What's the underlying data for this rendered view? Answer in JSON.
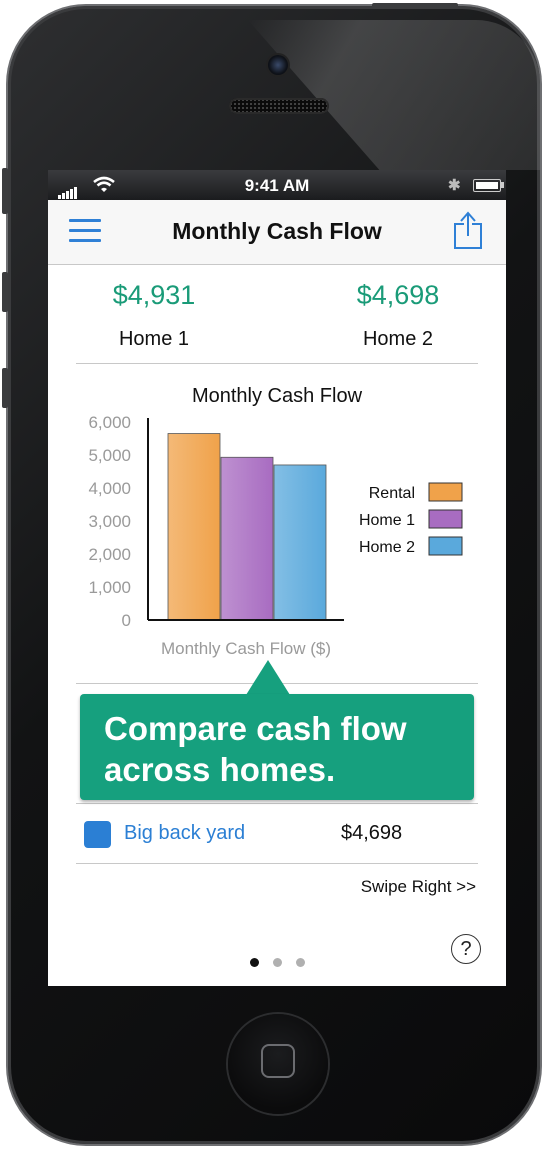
{
  "status_bar": {
    "time": "9:41 AM"
  },
  "nav": {
    "title": "Monthly Cash Flow"
  },
  "summary": [
    {
      "amount": "$4,931",
      "label": "Home 1"
    },
    {
      "amount": "$4,698",
      "label": "Home 2"
    }
  ],
  "chart_data": {
    "type": "bar",
    "title": "Monthly Cash Flow",
    "xlabel": "Monthly Cash Flow ($)",
    "ylabel": "",
    "ylim": [
      0,
      6000
    ],
    "yticks": [
      "6,000",
      "5,000",
      "4,000",
      "3,000",
      "2,000",
      "1,000",
      "0"
    ],
    "ytick_values": [
      6000,
      5000,
      4000,
      3000,
      2000,
      1000,
      0
    ],
    "legend_position": "right",
    "series": [
      {
        "name": "Rental",
        "values": [
          5650
        ],
        "color": "#f0a24a"
      },
      {
        "name": "Home 1",
        "values": [
          4931
        ],
        "color": "#a86cc1"
      },
      {
        "name": "Home 2",
        "values": [
          4698
        ],
        "color": "#5aa9dc"
      }
    ]
  },
  "tooltip": {
    "text": "Compare cash flow across homes."
  },
  "list_row": {
    "label": "Big back yard",
    "value": "$4,698",
    "swatch_color": "#2b7fd4"
  },
  "swipe": {
    "text": "Swipe Right >>"
  },
  "pager": {
    "count": 3,
    "active": 0
  },
  "help": {
    "icon": "question-icon",
    "text": "?"
  },
  "colors": {
    "accent": "#2f80d6",
    "money": "#1a9b78",
    "tooltip": "#16a07e"
  }
}
